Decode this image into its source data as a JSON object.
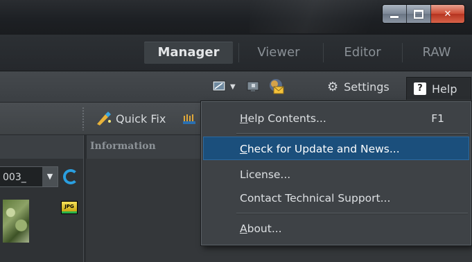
{
  "window": {
    "controls": [
      "minimize",
      "maximize",
      "close"
    ]
  },
  "modes": [
    "Manager",
    "Viewer",
    "Editor",
    "RAW"
  ],
  "active_mode": "Manager",
  "toolbar": {
    "settings_label": "Settings",
    "help_label": "Help",
    "help_glyph": "?"
  },
  "lower_bar": {
    "quick_fix_label": "Quick Fix"
  },
  "info_panel": {
    "title": "Information"
  },
  "left_panel": {
    "combo_value": "003_",
    "thumb_badge": "JPG"
  },
  "help_menu": {
    "items": [
      {
        "label": "Help Contents...",
        "shortcut": "F1",
        "mnemonic": "H"
      },
      {
        "label": "Check for Update and News...",
        "mnemonic": "C",
        "highlighted": true
      },
      {
        "label": "License..."
      },
      {
        "label": "Contact Technical Support..."
      },
      {
        "label": "About...",
        "mnemonic": "A"
      }
    ]
  },
  "colors": {
    "menu_highlight": "#1b4f7c",
    "refresh_icon": "#2a9fe0",
    "close_button": "#cc4b33"
  }
}
